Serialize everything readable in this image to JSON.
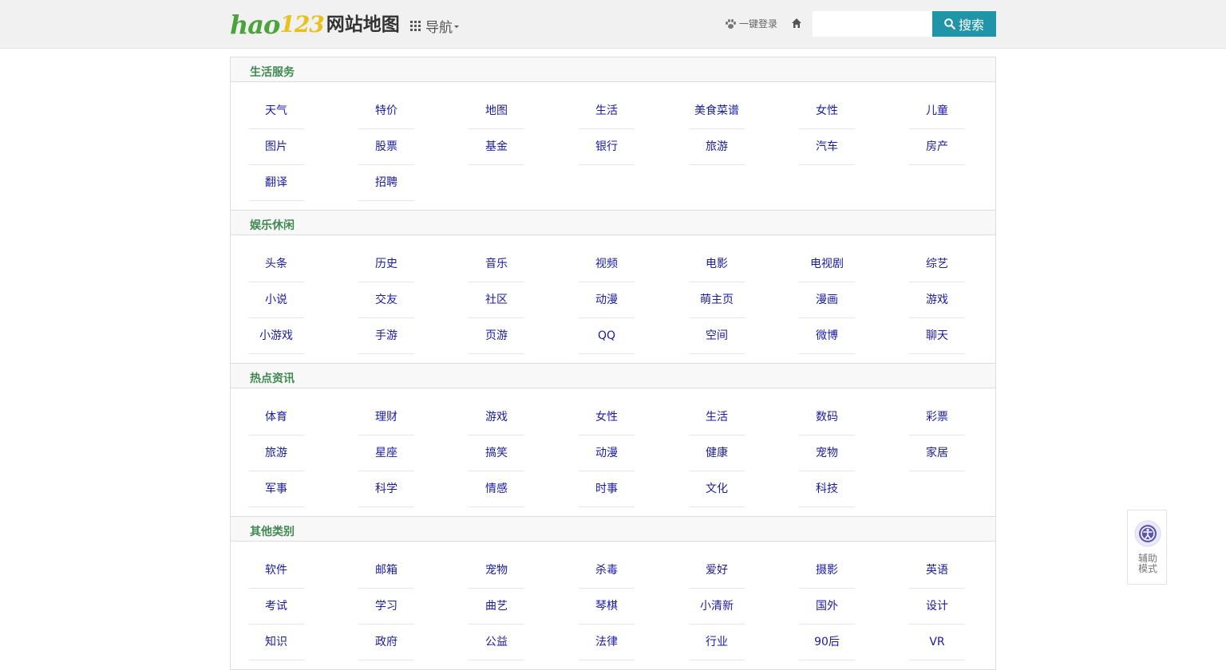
{
  "header": {
    "logo_hao": "hao",
    "logo_num": "123",
    "logo_sitemap": "网站地图",
    "nav_label": "导航",
    "login_label": "一键登录",
    "search_placeholder": "",
    "search_button": "搜索"
  },
  "sections": [
    {
      "title": "生活服务",
      "links": [
        "天气",
        "特价",
        "地图",
        "生活",
        "美食菜谱",
        "女性",
        "儿童",
        "图片",
        "股票",
        "基金",
        "银行",
        "旅游",
        "汽车",
        "房产",
        "翻译",
        "招聘"
      ]
    },
    {
      "title": "娱乐休闲",
      "links": [
        "头条",
        "历史",
        "音乐",
        "视频",
        "电影",
        "电视剧",
        "综艺",
        "小说",
        "交友",
        "社区",
        "动漫",
        "萌主页",
        "漫画",
        "游戏",
        "小游戏",
        "手游",
        "页游",
        "QQ",
        "空间",
        "微博",
        "聊天"
      ]
    },
    {
      "title": "热点资讯",
      "links": [
        "体育",
        "理财",
        "游戏",
        "女性",
        "生活",
        "数码",
        "彩票",
        "旅游",
        "星座",
        "搞笑",
        "动漫",
        "健康",
        "宠物",
        "家居",
        "军事",
        "科学",
        "情感",
        "时事",
        "文化",
        "科技"
      ]
    },
    {
      "title": "其他类别",
      "links": [
        "软件",
        "邮箱",
        "宠物",
        "杀毒",
        "爱好",
        "摄影",
        "英语",
        "考试",
        "学习",
        "曲艺",
        "琴棋",
        "小清新",
        "国外",
        "设计",
        "知识",
        "政府",
        "公益",
        "法律",
        "行业",
        "90后",
        "VR"
      ]
    }
  ],
  "assist": {
    "line1": "辅助",
    "line2": "模式"
  },
  "colors": {
    "accent": "#2195a8",
    "section_title": "#3f8a52",
    "link": "#1a1aa6"
  }
}
